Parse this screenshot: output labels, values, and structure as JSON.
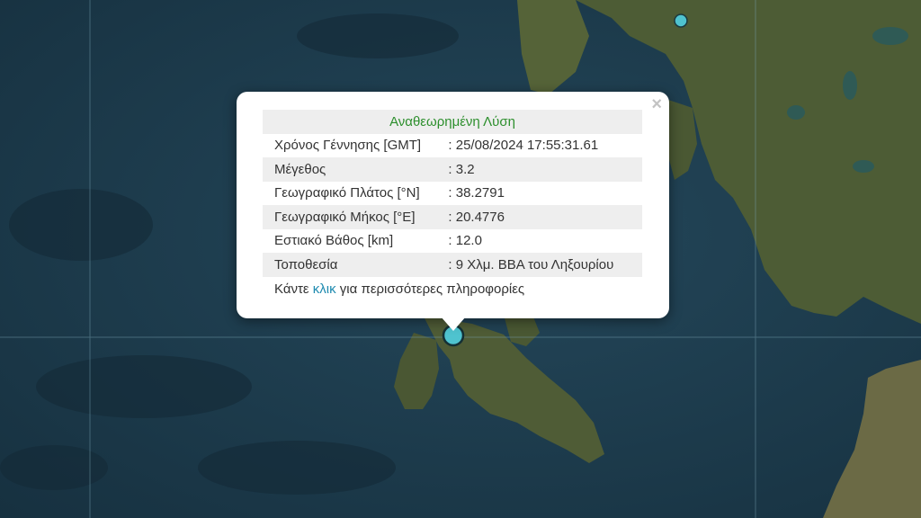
{
  "colors": {
    "sea": "#1d3a4c",
    "land": "#4d5c35",
    "marker": "#4fc3cf",
    "title_green": "#2d8f2d",
    "link": "#1f8bb0"
  },
  "map": {
    "markers": [
      {
        "name": "event-marker-main"
      },
      {
        "name": "event-marker-north"
      }
    ]
  },
  "popup": {
    "title": "Αναθεωρημένη Λύση",
    "close_icon": "×",
    "rows": [
      {
        "label": "Χρόνος Γέννησης [GMT]",
        "value": ": 25/08/2024 17:55:31.61"
      },
      {
        "label": "Μέγεθος",
        "value": ": 3.2"
      },
      {
        "label": "Γεωγραφικό Πλάτος [°N]",
        "value": ": 38.2791"
      },
      {
        "label": "Γεωγραφικό Μήκος [°E]",
        "value": ": 20.4776"
      },
      {
        "label": "Εστιακό Βάθος [km]",
        "value": ": 12.0"
      },
      {
        "label": "Τοποθεσία",
        "value": ": 9 Χλμ. ΒΒΑ του Ληξουρίου"
      }
    ],
    "more_prefix": "Κάντε ",
    "more_link": "κλικ",
    "more_suffix": " για περισσότερες πληροφορίες"
  }
}
